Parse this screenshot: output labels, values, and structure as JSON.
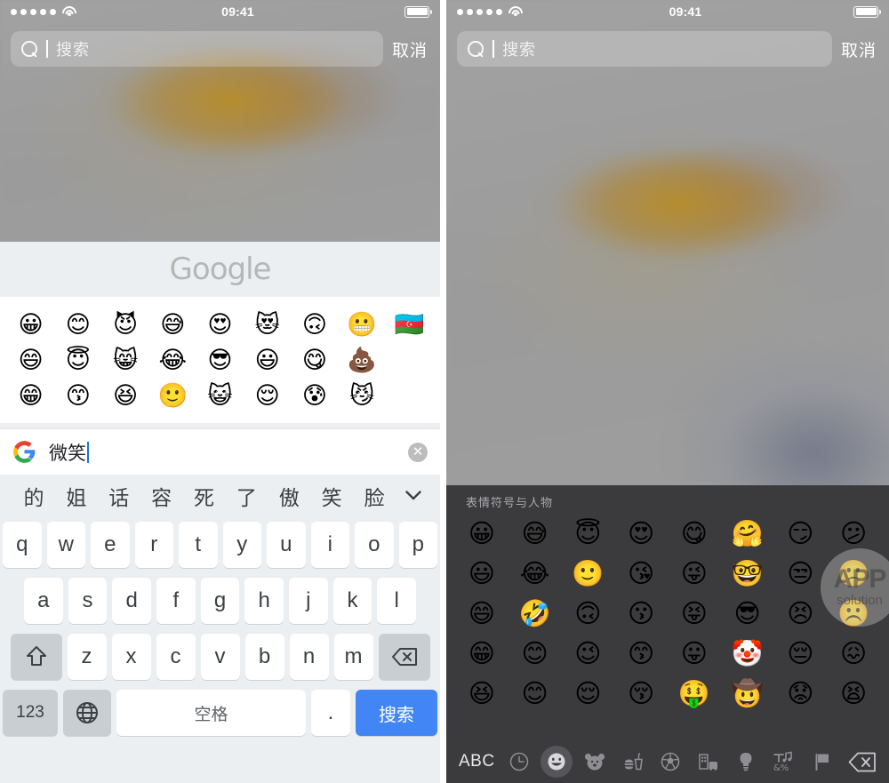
{
  "status_bar": {
    "signal_dots": 5,
    "wifi_icon": "wifi-icon",
    "time": "09:41",
    "battery_icon": "battery-full-icon"
  },
  "search_bar": {
    "search_icon": "search-icon",
    "placeholder": "搜索",
    "value": "",
    "cancel_label": "取消"
  },
  "left_panel": {
    "brand": "Google",
    "emoji_suggestions": {
      "rows": [
        [
          "😀",
          "😊",
          "😈",
          "😅",
          "😍",
          "😻",
          "🙃",
          "😬",
          "🇦🇿"
        ],
        [
          "😄",
          "😇",
          "😸",
          "😂",
          "😎",
          "😃",
          "😋",
          "💩"
        ],
        [
          "😁",
          "😙",
          "😆",
          "🙂",
          "😺",
          "😌",
          "😰",
          "😼"
        ]
      ]
    },
    "query_field": {
      "logo_icon": "google-g-icon",
      "value": "微笑",
      "clear_icon": "clear-circle-icon"
    },
    "candidates": {
      "items": [
        "的",
        "姐",
        "话",
        "容",
        "死",
        "了",
        "傲",
        "笑",
        "脸"
      ],
      "expand_icon": "chevron-down-icon"
    },
    "keyboard": {
      "row1": [
        "q",
        "w",
        "e",
        "r",
        "t",
        "y",
        "u",
        "i",
        "o",
        "p"
      ],
      "row2": [
        "a",
        "s",
        "d",
        "f",
        "g",
        "h",
        "j",
        "k",
        "l"
      ],
      "row3": [
        "z",
        "x",
        "c",
        "v",
        "b",
        "n",
        "m"
      ],
      "shift_icon": "shift-arrow-icon",
      "backspace_icon": "backspace-icon",
      "numbers_label": "123",
      "globe_icon": "globe-icon",
      "space_label": "空格",
      "period_label": ".",
      "search_label": "搜索"
    }
  },
  "right_panel": {
    "section_title": "表情符号与人物",
    "emoji_grid": {
      "rows": [
        [
          "😀",
          "😅",
          "😇",
          "😍",
          "😋",
          "🤗",
          "😏",
          "😕"
        ],
        [
          "😃",
          "😂",
          "🙂",
          "😘",
          "😜",
          "🤓",
          "😒",
          "🙁"
        ],
        [
          "😄",
          "🤣",
          "🙃",
          "😗",
          "😝",
          "😎",
          "😣",
          "☹️"
        ],
        [
          "😁",
          "😊",
          "😉",
          "😙",
          "😛",
          "🤡",
          "😔",
          "😖"
        ],
        [
          "😆",
          "😊",
          "😌",
          "😚",
          "🤑",
          "🤠",
          "😟",
          "😫"
        ]
      ]
    },
    "toolbar": {
      "abc_label": "ABC",
      "categories": [
        {
          "icon": "recents-clock-icon",
          "selected": false
        },
        {
          "icon": "smileys-people-icon",
          "selected": true
        },
        {
          "icon": "animals-nature-icon",
          "selected": false
        },
        {
          "icon": "food-drink-icon",
          "selected": false
        },
        {
          "icon": "activity-sports-icon",
          "selected": false
        },
        {
          "icon": "travel-places-icon",
          "selected": false
        },
        {
          "icon": "objects-bulb-icon",
          "selected": false
        },
        {
          "icon": "symbols-icon",
          "selected": false
        },
        {
          "icon": "flags-icon",
          "selected": false
        }
      ],
      "backspace_icon": "backspace-icon"
    }
  },
  "watermark": {
    "primary": "APP",
    "secondary": "solution"
  },
  "colors": {
    "accent_blue": "#4285f4",
    "keyboard_bg": "#eceff1",
    "ios_keyboard_bg": "#3b3b3d",
    "status_text": "#ffffff"
  }
}
